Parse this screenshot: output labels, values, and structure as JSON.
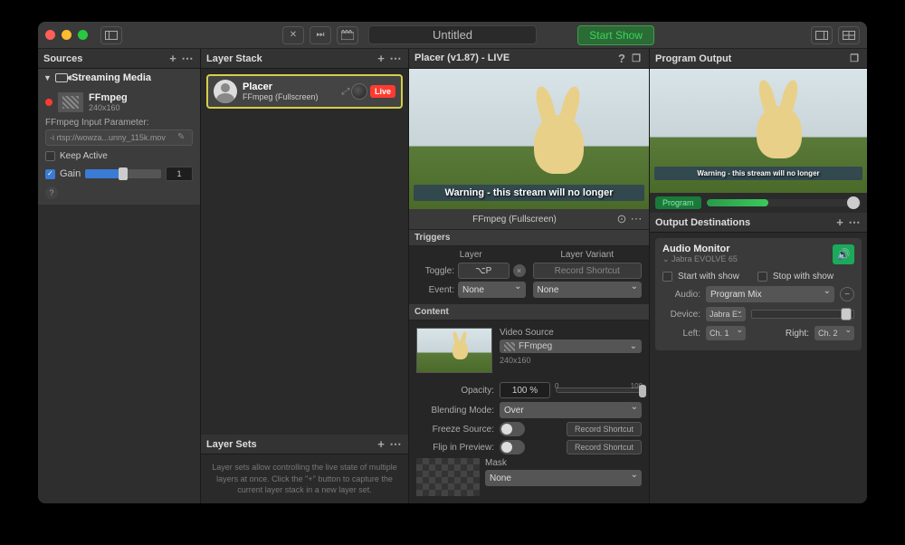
{
  "titlebar": {
    "title": "Untitled",
    "start_label": "Start Show"
  },
  "sources": {
    "header": "Sources",
    "group": "Streaming Media",
    "item": {
      "name": "FFmpeg",
      "dims": "240x160"
    },
    "param_label": "FFmpeg Input Parameter:",
    "param_value": "-i rtsp://wowza...unny_115k.mov",
    "keep_active": "Keep Active",
    "gain_label": "Gain",
    "gain_value": "1"
  },
  "layer_stack": {
    "header": "Layer Stack",
    "card": {
      "name": "Placer",
      "sub": "FFmpeg (Fullscreen)",
      "live": "Live"
    },
    "sets_header": "Layer Sets",
    "sets_help": "Layer sets allow controlling the live state of multiple layers at once. Click the \"+\" button to capture the current layer stack in a new layer set."
  },
  "placer": {
    "header": "Placer (v1.87) - LIVE",
    "preview_warn": "Warning - this stream will no longer",
    "name_bar": "FFmpeg (Fullscreen)",
    "triggers": {
      "title": "Triggers",
      "col_layer": "Layer",
      "col_variant": "Layer Variant",
      "toggle_label": "Toggle:",
      "toggle_value": "⌥P",
      "event_label": "Event:",
      "none": "None",
      "record": "Record Shortcut"
    },
    "content": {
      "title": "Content",
      "video_source": "Video Source",
      "source_value": "FFmpeg",
      "dims": "240x160",
      "opacity_label": "Opacity:",
      "opacity_value": "100 %",
      "opacity_min": "0",
      "opacity_max": "100",
      "blend_label": "Blending Mode:",
      "blend_value": "Over",
      "freeze_label": "Freeze Source:",
      "flip_label": "Flip in Preview:",
      "record": "Record Shortcut",
      "mask_label": "Mask",
      "mask_value": "None"
    }
  },
  "output": {
    "header": "Program Output",
    "preview_warn": "Warning - this stream will no longer",
    "program_chip": "Program",
    "dest_header": "Output Destinations",
    "audio": {
      "title": "Audio Monitor",
      "device_sub": "Jabra EVOLVE 65",
      "start": "Start with show",
      "stop": "Stop with show",
      "audio_label": "Audio:",
      "audio_value": "Program Mix",
      "device_label": "Device:",
      "device_value": "Jabra E..",
      "left_label": "Left:",
      "left_value": "Ch. 1",
      "right_label": "Right:",
      "right_value": "Ch. 2"
    }
  }
}
